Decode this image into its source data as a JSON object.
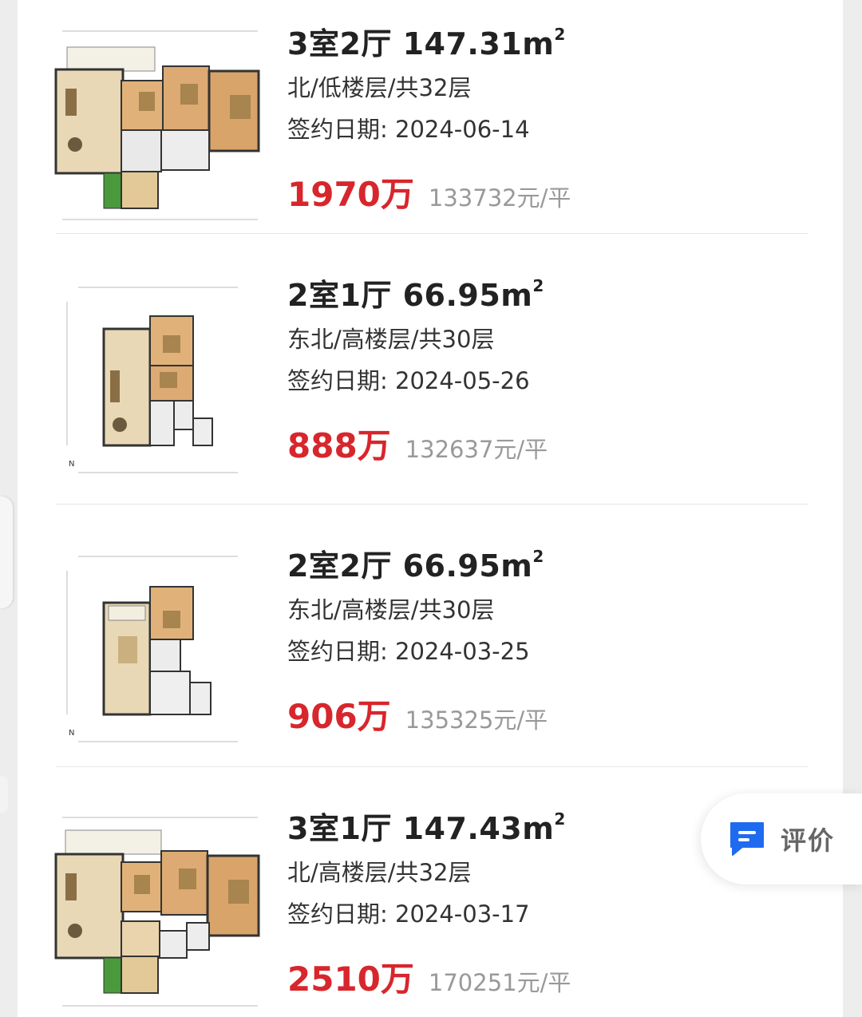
{
  "listings": [
    {
      "title": "3室2厅 147.31m",
      "title_sup": "2",
      "details": "北/低楼层/共32层",
      "sign_date": "签约日期: 2024-06-14",
      "price": "1970万",
      "unit_price": "133732元/平"
    },
    {
      "title": "2室1厅 66.95m",
      "title_sup": "2",
      "details": "东北/高楼层/共30层",
      "sign_date": "签约日期: 2024-05-26",
      "price": "888万",
      "unit_price": "132637元/平"
    },
    {
      "title": "2室2厅 66.95m",
      "title_sup": "2",
      "details": "东北/高楼层/共30层",
      "sign_date": "签约日期: 2024-03-25",
      "price": "906万",
      "unit_price": "135325元/平"
    },
    {
      "title": "3室1厅 147.43m",
      "title_sup": "2",
      "details": "北/高楼层/共32层",
      "sign_date": "签约日期: 2024-03-17",
      "price": "2510万",
      "unit_price": "170251元/平"
    }
  ],
  "review_button": {
    "label": "评价",
    "icon": "comment-icon"
  },
  "colors": {
    "price": "#d7262c",
    "unit_price": "#999999",
    "review_icon": "#1f6bf0"
  }
}
